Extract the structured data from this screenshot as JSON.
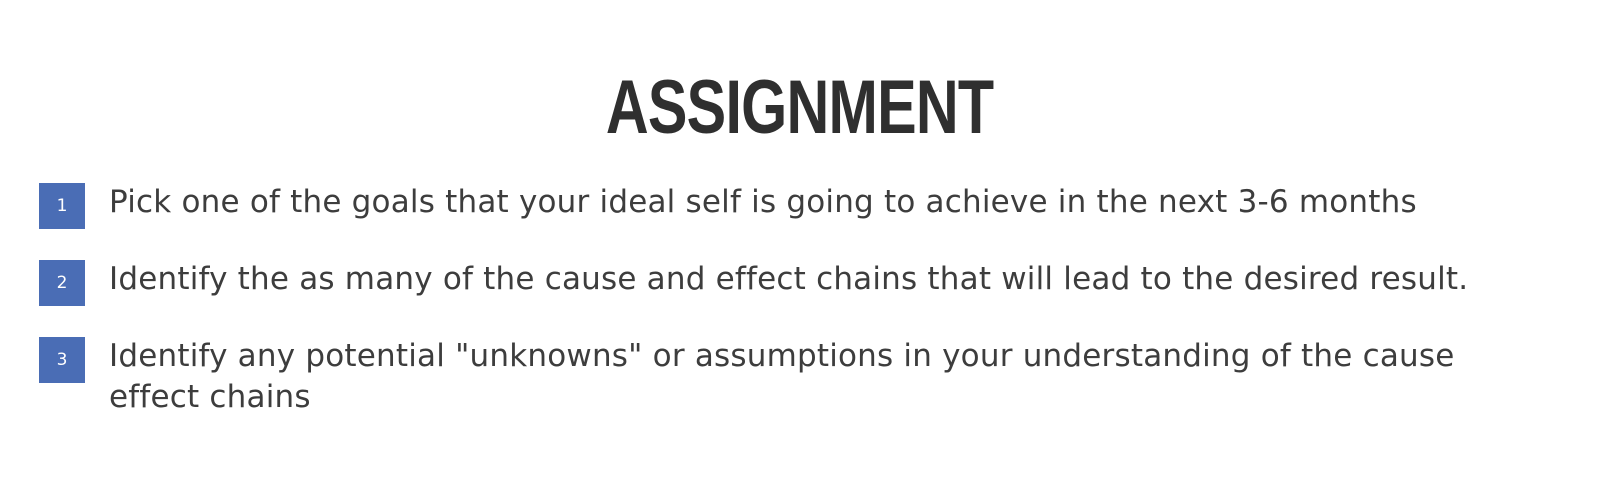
{
  "title": "ASSIGNMENT",
  "items": [
    {
      "number": "1",
      "text": "Pick one of the goals that your ideal self is going to achieve in the next 3-6 months"
    },
    {
      "number": "2",
      "text": "Identify the as many of the cause and effect chains that will lead to the desired result."
    },
    {
      "number": "3",
      "text": "Identify any potential \"unknowns\" or assumptions in your understanding of the cause effect chains"
    }
  ],
  "colors": {
    "badge": "#4a6db5",
    "text": "#3d3d3d",
    "title": "#2f2f2f"
  }
}
